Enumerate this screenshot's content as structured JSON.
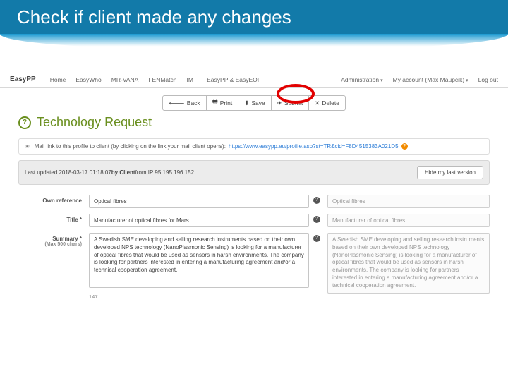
{
  "slide_title": "Check if client made any changes",
  "nav": {
    "brand": "EasyPP",
    "items": [
      "Home",
      "EasyWho",
      "MR-VANA",
      "FENMatch",
      "IMT",
      "EasyPP & EasyEOI"
    ],
    "admin": "Administration",
    "account": "My account (Max Maupcik)",
    "logout": "Log out"
  },
  "toolbar": {
    "back": "Back",
    "print": "Print",
    "save": "Save",
    "submit": "Submit",
    "delete": "Delete"
  },
  "heading": {
    "flag": "?",
    "title": "Technology Request"
  },
  "mail_panel": {
    "label": "Mail link to this profile to client (by clicking on the link your mail client opens):",
    "url": "https://www.easypp.eu/profile.asp?st=TR&cid=F8D4515383A021D5"
  },
  "updated_panel": {
    "prefix": "Last updated 2018-03-17 01:18:07 ",
    "by": "by Client",
    "suffix": " from IP 95.195.196.152",
    "hide_btn": "Hide my last version"
  },
  "form": {
    "own_ref": {
      "label": "Own reference",
      "value": "Optical fibres",
      "ro": "Optical fibres"
    },
    "title": {
      "label": "Title *",
      "value": "Manufacturer of optical fibres for Mars",
      "ro": "Manufacturer of optical fibres"
    },
    "summary": {
      "label": "Summary *",
      "hint": "(Max 500 chars)",
      "value": "A Swedish SME developing and selling research instruments based on their own developed NPS technology (NanoPlasmonic Sensing) is looking for a manufacturer of optical fibres that would be used as sensors in harsh environments. The company is looking for partners interested in entering a manufacturing agreement and/or a technical cooperation agreement.",
      "ro": "A Swedish SME developing and selling research instruments based on their own developed NPS technology (NanoPlasmonic Sensing) is looking for a manufacturer of optical fibres that would be used as sensors in harsh environments. The company is looking for partners interested in entering a manufacturing agreement and/or a technical cooperation agreement.",
      "counter": "147"
    }
  }
}
